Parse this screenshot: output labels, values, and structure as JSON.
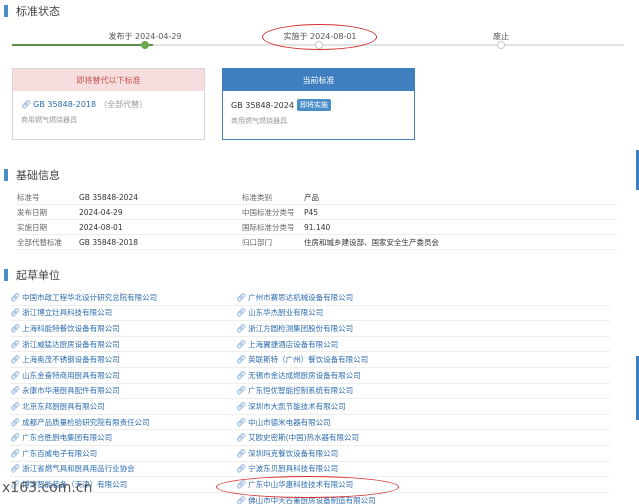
{
  "sections": {
    "status_title": "标准状态",
    "basic_title": "基础信息",
    "drafters_title": "起草单位"
  },
  "timeline": {
    "published": "发布于 2024-04-29",
    "implemented": "实施于 2024-08-01",
    "abolished": "废止",
    "progress_fraction": 0.23
  },
  "cards": {
    "old": {
      "header": "即将替代以下标准",
      "code": "GB 35848-2018",
      "note": "（全部代替）",
      "desc": "商用燃气燃烧器具"
    },
    "current": {
      "header": "当前标准",
      "code": "GB 35848-2024",
      "badge": "即将实施",
      "desc": "商用燃气燃烧器具"
    }
  },
  "basic_info": [
    {
      "l1": "标准号",
      "v1": "GB 35848-2024",
      "l2": "标准类别",
      "v2": "产品"
    },
    {
      "l1": "发布日期",
      "v1": "2024-04-29",
      "l2": "中国标准分类号",
      "v2": "P45"
    },
    {
      "l1": "实施日期",
      "v1": "2024-08-01",
      "l2": "国际标准分类号",
      "v2": "91.140"
    },
    {
      "l1": "全部代替标准",
      "v1": "GB 35848-2018",
      "l2": "归口部门",
      "v2": "住房和城乡建设部、国家安全生产委员会"
    }
  ],
  "drafters": [
    [
      "中国市政工程华北设计研究总院有限公司",
      "广州市赛思达机械设备有限公司"
    ],
    [
      "浙江博立灶具科技有限公司",
      "山东华杰厨业有限公司"
    ],
    [
      "上海科能特餐饮设备有限公司",
      "浙江方圆检测集团股份有限公司"
    ],
    [
      "浙江威猛达厨房设备有限公司",
      "上海翼捷酒店设备有限公司"
    ],
    [
      "上海奥茂不锈钢设备有限公司",
      "英联斯特（广州）餐饮设备有限公司"
    ],
    [
      "山东金奋特商用厨具有限公司",
      "无锡市金达成燃厨房设备有限公司"
    ],
    [
      "永康市华港厨具配件有限公司",
      "广东恒优智能控制系统有限公司"
    ],
    [
      "北京东邦厨厨具有限公司",
      "深圳市大凯节能技术有限公司"
    ],
    [
      "成都产品质量检验研究院有限责任公司",
      "中山市德米电器有限公司"
    ],
    [
      "广东合胜厨电集团有限公司",
      "艾欧史密斯(中国)热水器有限公司"
    ],
    [
      "广东百威电子有限公司",
      "深圳玛克餐饮设备有限公司"
    ],
    [
      "浙江省燃气具和厨具用品行业协会",
      "宁波东贝厨具科技有限公司"
    ],
    [
      "博涛智能装备（天津）有限公司",
      "广东中山华惠科技技术有限公司"
    ],
    [
      "",
      "佛山市中天谷董厨房设备制造有限公司"
    ]
  ],
  "watermark": "x163.com.cn",
  "colors": {
    "accent": "#3f7fbf",
    "progress": "#6aa84f",
    "annotation": "#d43030",
    "old_header_bg": "#f6dede"
  }
}
